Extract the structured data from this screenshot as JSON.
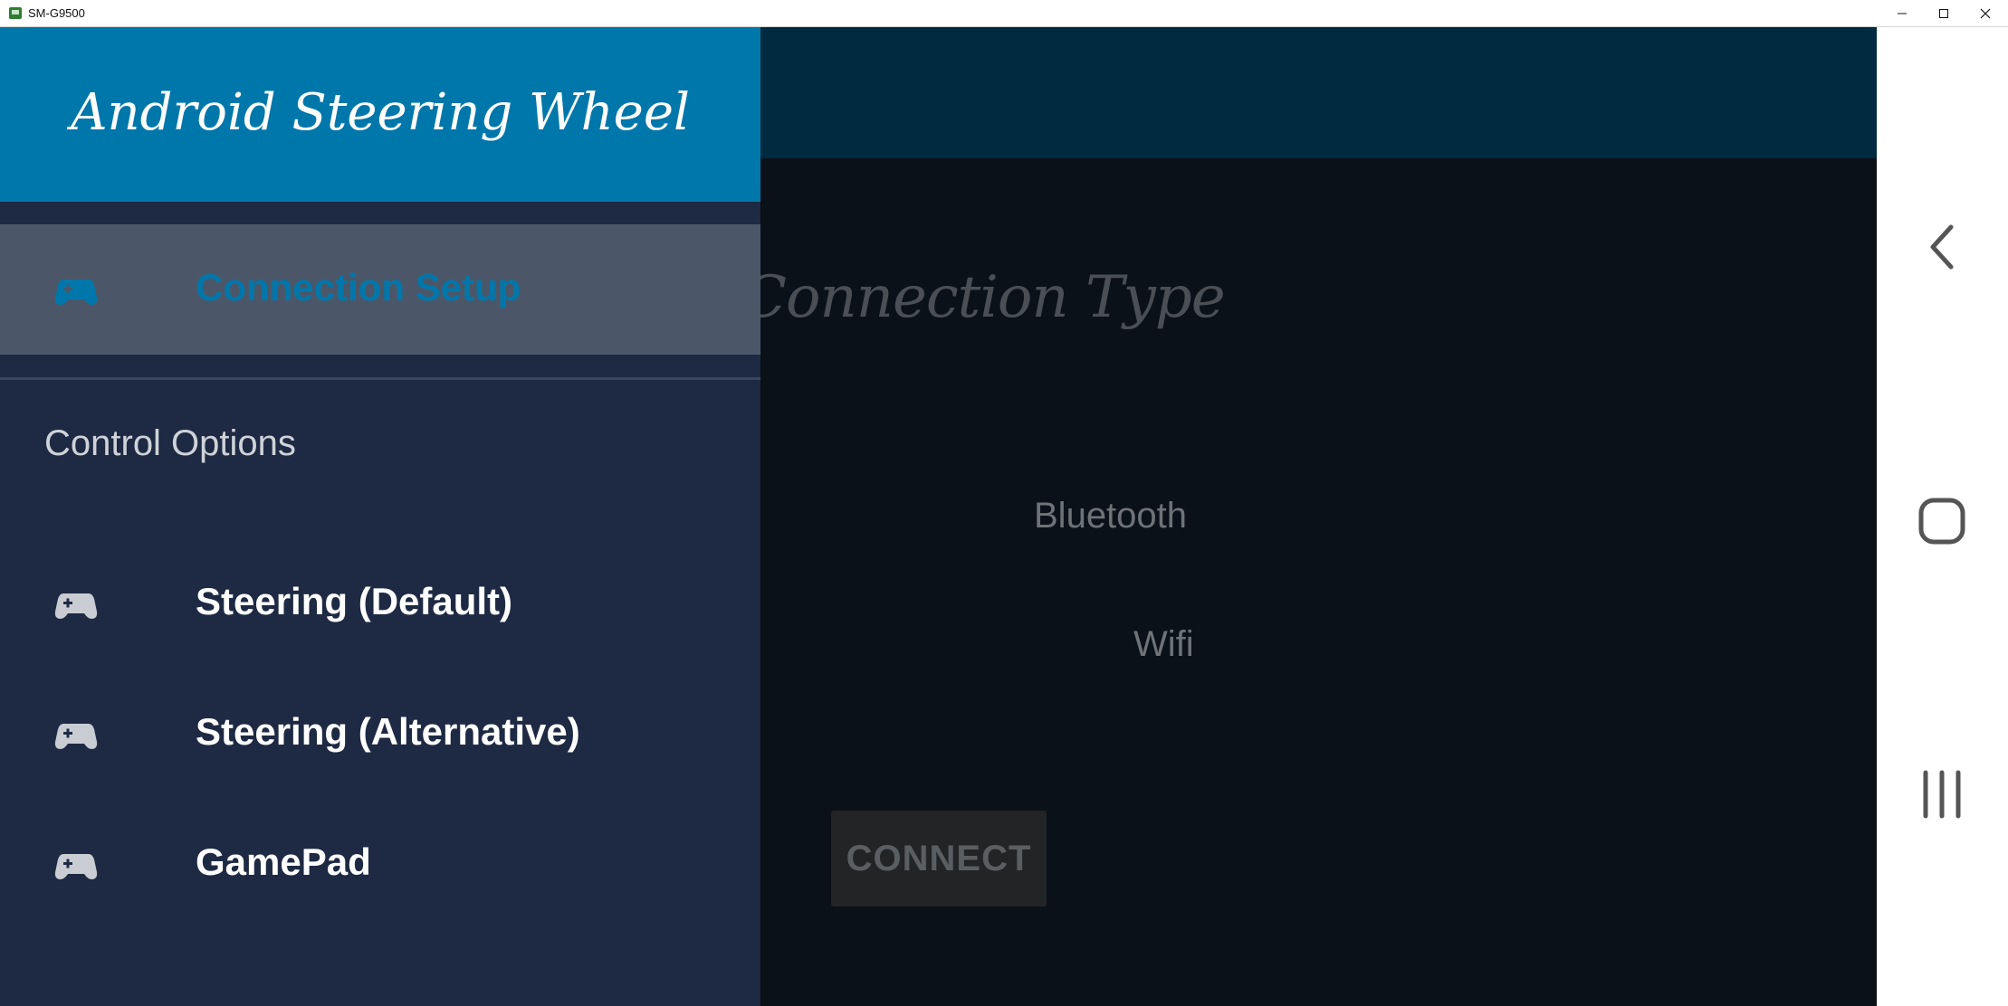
{
  "window": {
    "title": "SM-G9500",
    "controls": [
      "minimize",
      "maximize",
      "close"
    ]
  },
  "app": {
    "brand": "Android Steering Wheel",
    "content": {
      "title": "Connection Type",
      "options": [
        "Bluetooth",
        "Wifi"
      ],
      "connect_label": "CONNECT"
    },
    "drawer": {
      "active_item": "Connection Setup",
      "section_header": "Control Options",
      "items": [
        {
          "label": "Connection Setup",
          "icon": "gamepad-icon"
        },
        {
          "label": "Steering (Default)",
          "icon": "gamepad-icon"
        },
        {
          "label": "Steering (Alternative)",
          "icon": "gamepad-icon"
        },
        {
          "label": "GamePad",
          "icon": "gamepad-icon"
        }
      ]
    }
  },
  "navigation_bar": {
    "keys": [
      "back",
      "home",
      "recents"
    ]
  },
  "colors": {
    "drawer_header": "#0077ab",
    "drawer_bg": "#1e2a43",
    "active_item_bg": "#4b5769",
    "active_item_text": "#0077ab",
    "toolbar": "#002a3f",
    "content_bg": "#0b1119"
  }
}
